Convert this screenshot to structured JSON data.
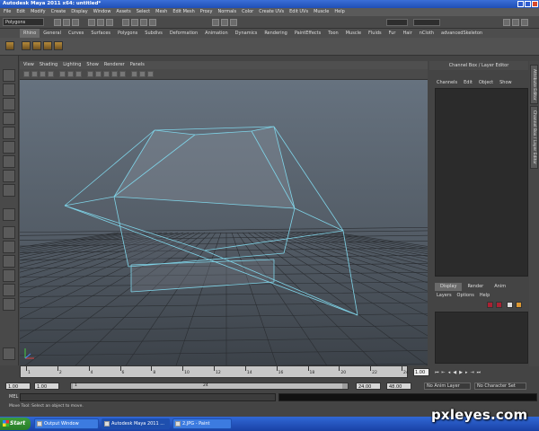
{
  "window": {
    "title": "Autodesk Maya 2011 x64: untitled*"
  },
  "menubar": [
    "File",
    "Edit",
    "Modify",
    "Create",
    "Display",
    "Window",
    "Assets",
    "Select",
    "Mesh",
    "Edit Mesh",
    "Proxy",
    "Normals",
    "Color",
    "Create UVs",
    "Edit UVs",
    "Muscle",
    "Help"
  ],
  "statusline": {
    "mode": "Polygons"
  },
  "shelf": {
    "tabs": [
      "Rhino",
      "General",
      "Curves",
      "Surfaces",
      "Polygons",
      "Subdivs",
      "Deformation",
      "Animation",
      "Dynamics",
      "Rendering",
      "PaintEffects",
      "Toon",
      "Muscle",
      "Fluids",
      "Fur",
      "Hair",
      "nCloth",
      "advancedSkeleton"
    ],
    "active_tab": "Rhino"
  },
  "viewport": {
    "menu": [
      "View",
      "Shading",
      "Lighting",
      "Show",
      "Renderer",
      "Panels"
    ],
    "wire_color": "#7fd4e8",
    "grid_color": "#2a2d31"
  },
  "channel_box": {
    "header": "Channel Box / Layer Editor",
    "menu": [
      "Channels",
      "Edit",
      "Object",
      "Show"
    ]
  },
  "side_tabs": [
    "Attribute Editor",
    "Channel Box / Layer Editor"
  ],
  "layer_editor": {
    "tabs": [
      "Display",
      "Render",
      "Anim"
    ],
    "active_tab": "Display",
    "menu": [
      "Layers",
      "Options",
      "Help"
    ]
  },
  "time_slider": {
    "ticks": [
      "1",
      "2",
      "4",
      "6",
      "8",
      "10",
      "12",
      "14",
      "16",
      "18",
      "20",
      "22",
      "24"
    ],
    "current_frame": "1.00"
  },
  "range_slider": {
    "start": "1.00",
    "inner_start": "1.00",
    "bar_start": "1",
    "bar_end": "24",
    "end": "24.00",
    "anim_end": "48.00",
    "anim_layer": "No Anim Layer",
    "character_set": "No Character Set"
  },
  "command_line": {
    "label": "MEL"
  },
  "help_line": "Move Tool: Select an object to move.",
  "taskbar": {
    "start": "Start",
    "tasks": [
      {
        "label": "Output Window",
        "active": false
      },
      {
        "label": "Autodesk Maya 2011 ...",
        "active": true
      },
      {
        "label": "2.JPG - Paint",
        "active": false
      }
    ]
  },
  "watermark": "pxleyes.com"
}
